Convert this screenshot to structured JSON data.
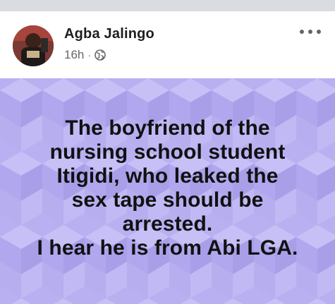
{
  "post": {
    "author": "Agba Jalingo",
    "time": "16h",
    "separator": "·",
    "privacy_icon": "globe-icon",
    "more_icon": "more-options-icon",
    "text_lines": [
      "The boyfriend of the",
      "nursing school student",
      "Itigidi, who leaked the",
      "sex tape should be",
      "arrested.",
      "I hear he is from Abi LGA."
    ],
    "background_color": "#b9b0f1",
    "text_color": "#111111"
  }
}
